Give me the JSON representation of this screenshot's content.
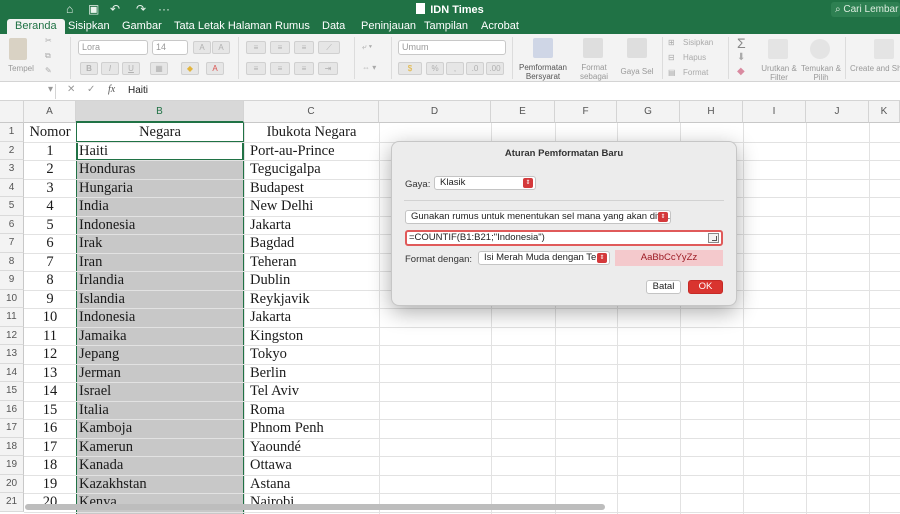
{
  "window": {
    "title": "IDN Times",
    "search_placeholder": "Cari Lembar"
  },
  "ribbon_tabs": [
    "Beranda",
    "Sisipkan",
    "Gambar",
    "Tata Letak Halaman",
    "Rumus",
    "Data",
    "Peninjauan",
    "Tampilan",
    "Acrobat"
  ],
  "ribbon": {
    "paste_label": "Tempel",
    "font_name": "Lora",
    "font_size": "14",
    "number_format": "Umum",
    "cond_format_label": "Pemformatan Bersyarat",
    "format_table_label": "Format sebagai Tabel",
    "cell_styles_label": "Gaya Sel",
    "insert_label": "Sisipkan",
    "delete_label": "Hapus",
    "format_label": "Format",
    "sort_filter_label": "Urutkan & Filter",
    "find_select_label": "Temukan & Pilih",
    "create_pdf_label": "Create and Sh Adobe PDF"
  },
  "formula_bar": {
    "name_box": "",
    "content": "Haiti"
  },
  "columns": [
    "A",
    "B",
    "C",
    "D",
    "E",
    "F",
    "G",
    "H",
    "I",
    "J",
    "K"
  ],
  "header_row": {
    "num": "Nomor",
    "negara": "Negara",
    "ibukota": "Ibukota Negara"
  },
  "rows": [
    {
      "n": "1",
      "negara": "Haiti",
      "ibukota": "Port-au-Prince"
    },
    {
      "n": "2",
      "negara": "Honduras",
      "ibukota": "Tegucigalpa"
    },
    {
      "n": "3",
      "negara": "Hungaria",
      "ibukota": "Budapest"
    },
    {
      "n": "4",
      "negara": "India",
      "ibukota": "New Delhi"
    },
    {
      "n": "5",
      "negara": "Indonesia",
      "ibukota": "Jakarta"
    },
    {
      "n": "6",
      "negara": "Irak",
      "ibukota": "Bagdad"
    },
    {
      "n": "7",
      "negara": "Iran",
      "ibukota": "Teheran"
    },
    {
      "n": "8",
      "negara": "Irlandia",
      "ibukota": "Dublin"
    },
    {
      "n": "9",
      "negara": "Islandia",
      "ibukota": "Reykjavik"
    },
    {
      "n": "10",
      "negara": "Indonesia",
      "ibukota": "Jakarta"
    },
    {
      "n": "11",
      "negara": "Jamaika",
      "ibukota": "Kingston"
    },
    {
      "n": "12",
      "negara": "Jepang",
      "ibukota": "Tokyo"
    },
    {
      "n": "13",
      "negara": "Jerman",
      "ibukota": "Berlin"
    },
    {
      "n": "14",
      "negara": "Israel",
      "ibukota": "Tel Aviv"
    },
    {
      "n": "15",
      "negara": "Italia",
      "ibukota": "Roma"
    },
    {
      "n": "16",
      "negara": "Kamboja",
      "ibukota": "Phnom Penh"
    },
    {
      "n": "17",
      "negara": "Kamerun",
      "ibukota": "Yaoundé"
    },
    {
      "n": "18",
      "negara": "Kanada",
      "ibukota": "Ottawa"
    },
    {
      "n": "19",
      "negara": "Kazakhstan",
      "ibukota": "Astana"
    },
    {
      "n": "20",
      "negara": "Kenya",
      "ibukota": "Nairobi"
    }
  ],
  "dialog": {
    "title": "Aturan Pemformatan Baru",
    "style_label": "Gaya:",
    "style_value": "Klasik",
    "rule_type": "Gunakan rumus untuk menentukan sel mana yang akan difo...",
    "formula": "=COUNTIF(B1:B21;\"Indonesia\")",
    "format_with_label": "Format dengan:",
    "format_with_value": "Isi Merah Muda dengan Te...",
    "preview_text": "AaBbCcYyZz",
    "cancel_label": "Batal",
    "ok_label": "OK"
  },
  "colors": {
    "excel_green": "#207245",
    "ok_red": "#d9342f",
    "preview_fill": "#f4c9cc"
  }
}
